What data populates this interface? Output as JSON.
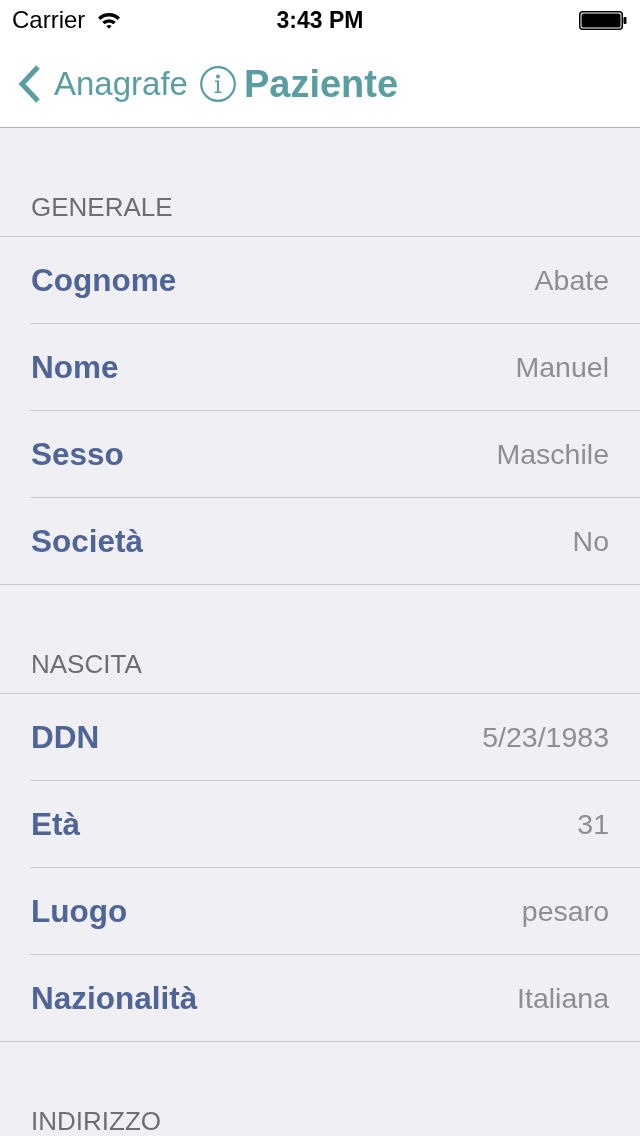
{
  "status_bar": {
    "carrier": "Carrier",
    "time": "3:43 PM"
  },
  "nav_bar": {
    "back_label": "Anagrafe",
    "title": "Paziente"
  },
  "sections": [
    {
      "header": "GENERALE",
      "rows": [
        {
          "label": "Cognome",
          "value": "Abate"
        },
        {
          "label": "Nome",
          "value": "Manuel"
        },
        {
          "label": "Sesso",
          "value": "Maschile"
        },
        {
          "label": "Società",
          "value": "No"
        }
      ]
    },
    {
      "header": "NASCITA",
      "rows": [
        {
          "label": "DDN",
          "value": "5/23/1983"
        },
        {
          "label": "Età",
          "value": "31"
        },
        {
          "label": "Luogo",
          "value": "pesaro"
        },
        {
          "label": "Nazionalità",
          "value": "Italiana"
        }
      ]
    },
    {
      "header": "INDIRIZZO"
    }
  ]
}
